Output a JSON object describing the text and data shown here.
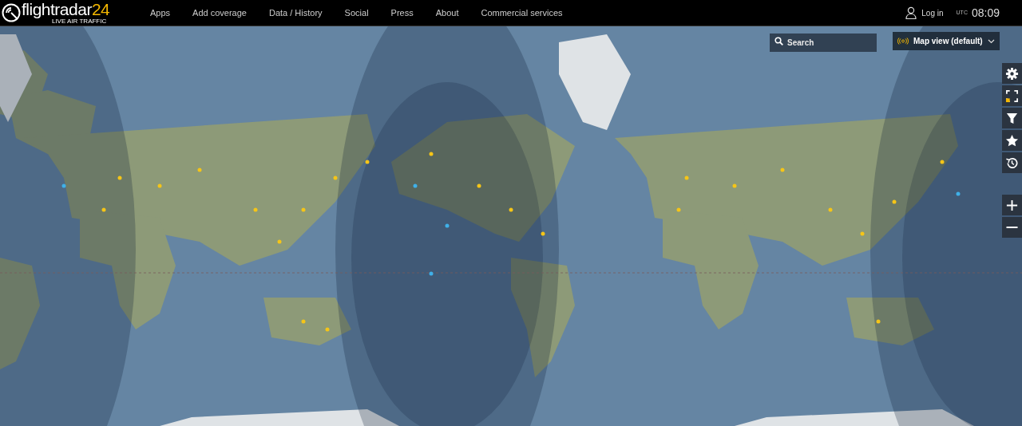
{
  "logo": {
    "name": "flightradar",
    "number": "24",
    "tagline": "LIVE AIR TRAFFIC"
  },
  "nav": [
    "Apps",
    "Add coverage",
    "Data / History",
    "Social",
    "Press",
    "About",
    "Commercial services"
  ],
  "login": "Log in",
  "clock": {
    "zone": "UTC",
    "time": "08:09"
  },
  "search": {
    "placeholder": "Search"
  },
  "map_view": {
    "label": "Map view (default)"
  },
  "tools": [
    {
      "kind": "settings"
    },
    {
      "kind": "fullscreen"
    },
    {
      "kind": "filter"
    },
    {
      "kind": "favorites"
    },
    {
      "kind": "playback"
    }
  ],
  "zoom": [
    {
      "kind": "in"
    },
    {
      "kind": "out"
    }
  ]
}
